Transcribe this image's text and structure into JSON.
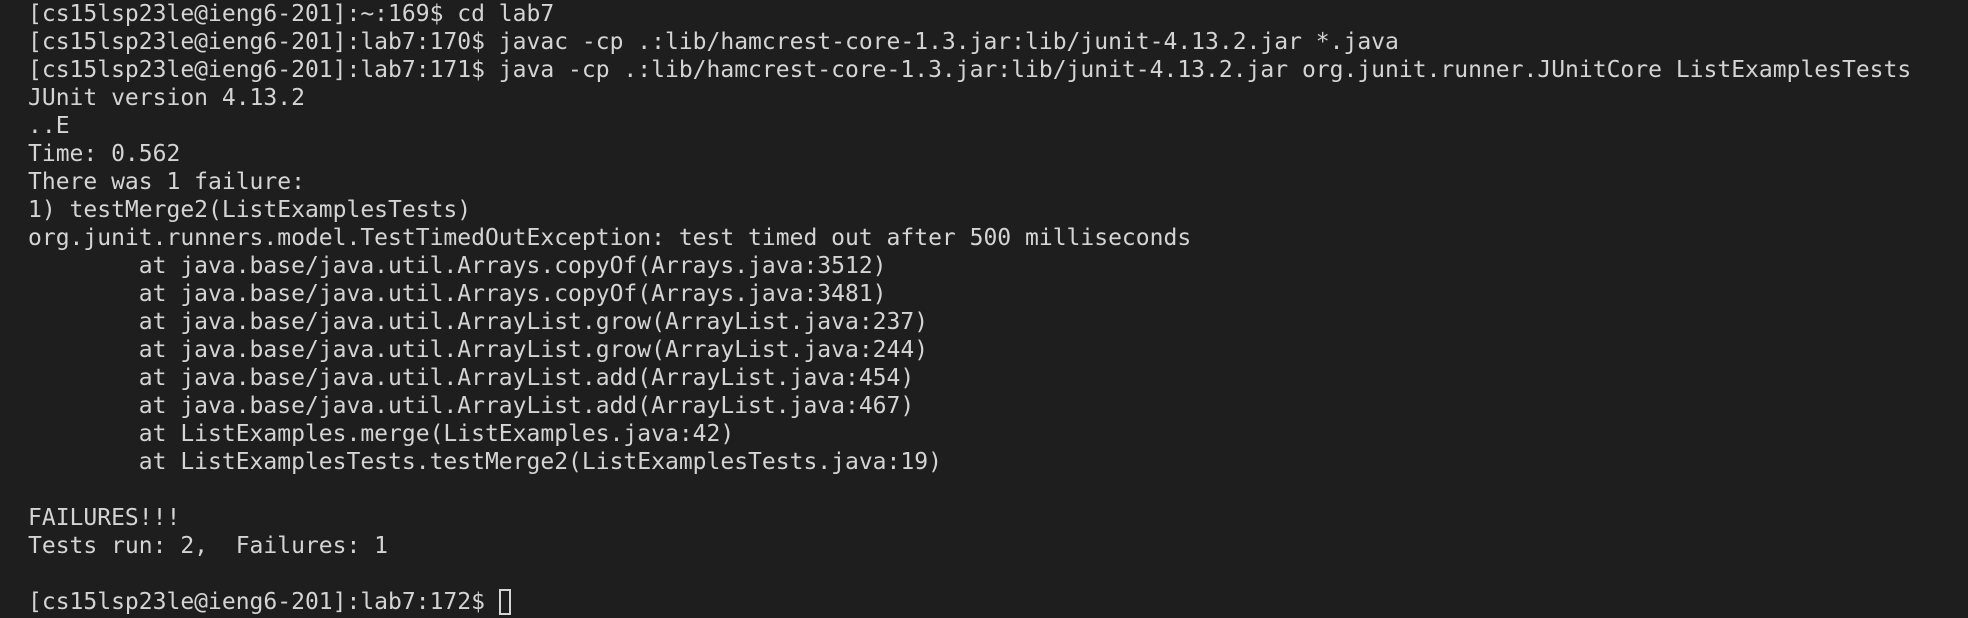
{
  "terminal": {
    "lines": [
      "[cs15lsp23le@ieng6-201]:~:169$ cd lab7",
      "[cs15lsp23le@ieng6-201]:lab7:170$ javac -cp .:lib/hamcrest-core-1.3.jar:lib/junit-4.13.2.jar *.java",
      "[cs15lsp23le@ieng6-201]:lab7:171$ java -cp .:lib/hamcrest-core-1.3.jar:lib/junit-4.13.2.jar org.junit.runner.JUnitCore ListExamplesTests",
      "JUnit version 4.13.2",
      "..E",
      "Time: 0.562",
      "There was 1 failure:",
      "1) testMerge2(ListExamplesTests)",
      "org.junit.runners.model.TestTimedOutException: test timed out after 500 milliseconds",
      "        at java.base/java.util.Arrays.copyOf(Arrays.java:3512)",
      "        at java.base/java.util.Arrays.copyOf(Arrays.java:3481)",
      "        at java.base/java.util.ArrayList.grow(ArrayList.java:237)",
      "        at java.base/java.util.ArrayList.grow(ArrayList.java:244)",
      "        at java.base/java.util.ArrayList.add(ArrayList.java:454)",
      "        at java.base/java.util.ArrayList.add(ArrayList.java:467)",
      "        at ListExamples.merge(ListExamples.java:42)",
      "        at ListExamplesTests.testMerge2(ListExamplesTests.java:19)",
      "",
      "FAILURES!!!",
      "Tests run: 2,  Failures: 1",
      ""
    ],
    "prompt": "[cs15lsp23le@ieng6-201]:lab7:172$ ",
    "colors": {
      "background": "#1e1e1e",
      "foreground": "#d4d4d4"
    }
  }
}
